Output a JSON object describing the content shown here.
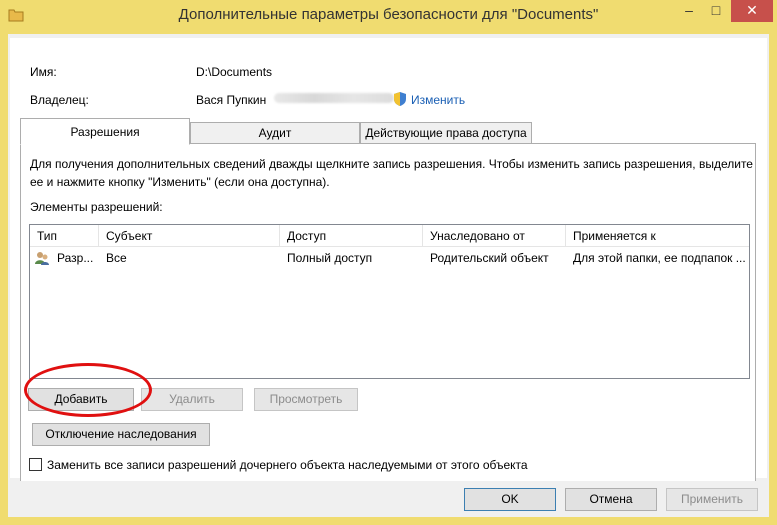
{
  "window": {
    "title": "Дополнительные параметры безопасности  для \"Documents\"",
    "minimize": "–",
    "maximize": "□",
    "close": "✕"
  },
  "info": {
    "name_label": "Имя:",
    "name_value": "D:\\Documents",
    "owner_label": "Владелец:",
    "owner_value": "Вася Пупкин",
    "change_link": "Изменить"
  },
  "tabs": [
    {
      "label": "Разрешения",
      "active": true
    },
    {
      "label": "Аудит",
      "active": false
    },
    {
      "label": "Действующие права доступа",
      "active": false
    }
  ],
  "description": {
    "line1": "Для получения дополнительных сведений дважды щелкните запись разрешения. Чтобы изменить запись разрешения, выделите",
    "line2": "ее и нажмите кнопку \"Изменить\" (если она доступна)."
  },
  "entries_label": "Элементы разрешений:",
  "table": {
    "columns": [
      "Тип",
      "Субъект",
      "Доступ",
      "Унаследовано от",
      "Применяется к"
    ],
    "rows": [
      [
        "Разр...",
        "Все",
        "Полный доступ",
        "Родительский объект",
        "Для этой папки, ее подпапок ..."
      ]
    ]
  },
  "buttons": {
    "add": "Добавить",
    "remove": "Удалить",
    "view": "Просмотреть",
    "disable_inheritance": "Отключение наследования",
    "ok": "OK",
    "cancel": "Отмена",
    "apply": "Применить"
  },
  "replace_checkbox": {
    "label": "Заменить все записи разрешений дочернего объекта наследуемыми от этого объекта",
    "checked": false
  },
  "colors": {
    "title_bar": "#f0dc70",
    "close_button": "#c7504b",
    "link": "#1a5fb4",
    "highlight_circle": "#e01010"
  }
}
